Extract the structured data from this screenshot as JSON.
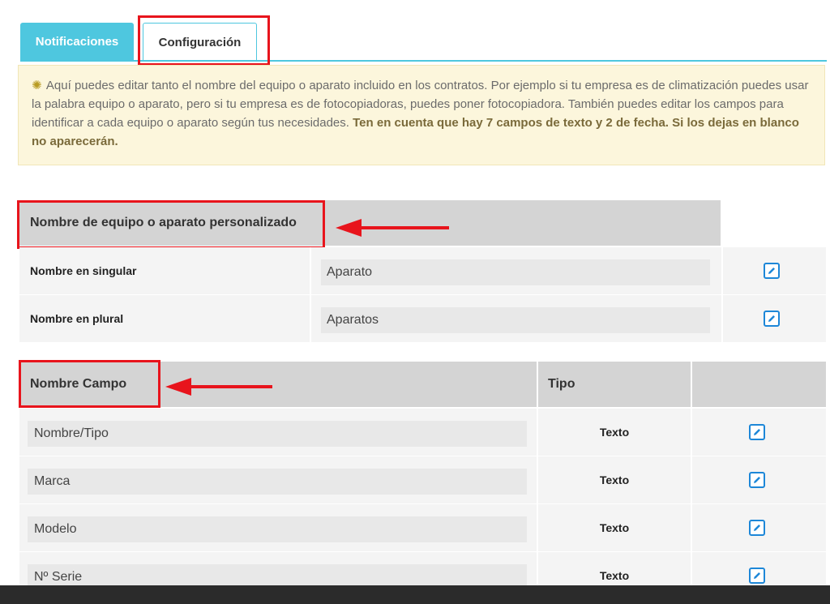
{
  "tabs": {
    "notifications": "Notificaciones",
    "configuration": "Configuración"
  },
  "info": {
    "text": "Aquí puedes editar tanto el nombre del equipo o aparato incluido en los contratos. Por ejemplo si tu empresa es de climatización puedes usar la palabra equipo o aparato, pero si tu empresa es de fotocopiadoras, puedes poner fotocopiadora. También puedes editar los campos para identificar a cada equipo o aparato según tus necesidades.",
    "bold": "Ten en cuenta que hay 7 campos de texto y 2 de fecha. Si los dejas en blanco no aparecerán."
  },
  "device_name": {
    "header": "Nombre de equipo o aparato personalizado",
    "rows": [
      {
        "label": "Nombre en singular",
        "value": "Aparato"
      },
      {
        "label": "Nombre en plural",
        "value": "Aparatos"
      }
    ]
  },
  "fields": {
    "header_name": "Nombre Campo",
    "header_type": "Tipo",
    "rows": [
      {
        "value": "Nombre/Tipo",
        "type": "Texto"
      },
      {
        "value": "Marca",
        "type": "Texto"
      },
      {
        "value": "Modelo",
        "type": "Texto"
      },
      {
        "value": "Nº Serie",
        "type": "Texto"
      }
    ]
  },
  "colors": {
    "accent": "#4ec7df",
    "highlight": "#e8141c",
    "info_bg": "#fcf6dc",
    "edit_icon": "#1d87d8"
  }
}
